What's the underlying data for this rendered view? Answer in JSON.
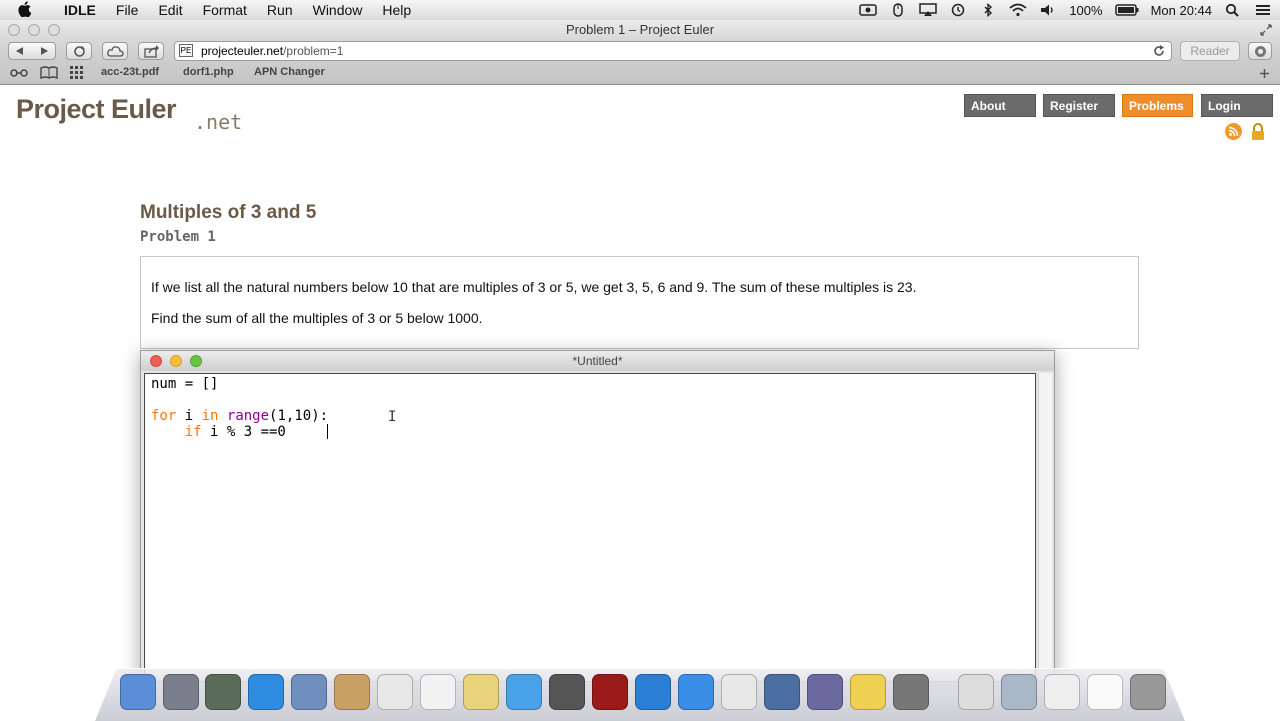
{
  "menubar": {
    "app": "IDLE",
    "menus": [
      "File",
      "Edit",
      "Format",
      "Run",
      "Window",
      "Help"
    ],
    "battery": "100%",
    "clock": "Mon 20:44"
  },
  "browser": {
    "window_title": "Problem 1 – Project Euler",
    "url_host": "projecteuler.net",
    "url_path": "/problem=1",
    "reader_label": "Reader",
    "bookmarks": [
      "acc-23t.pdf",
      "dorf1.php",
      "APN Changer"
    ]
  },
  "site": {
    "logo_main": "Project Euler",
    "logo_suffix": ".net",
    "nav": [
      "About",
      "Register",
      "Problems",
      "Login"
    ],
    "active_nav": "Problems",
    "accent_color": "#ef8d2b",
    "title_color": "#6b5a48"
  },
  "problem": {
    "title": "Multiples of 3 and 5",
    "number": "Problem 1",
    "paragraph1": "If we list all the natural numbers below 10 that are multiples of 3 or 5, we get 3, 5, 6 and 9. The sum of these multiples is 23.",
    "paragraph2": "Find the sum of all the multiples of 3 or 5 below 1000."
  },
  "idle_window": {
    "title": "*Untitled*",
    "code": {
      "line1": "num = []",
      "line3_kw_for": "for",
      "line3_var": " i ",
      "line3_kw_in": "in",
      "line3_sp": " ",
      "line3_builtin": "range",
      "line3_rest": "(1,10):",
      "line4_indent": "    ",
      "line4_kw_if": "if",
      "line4_rest": " i % 3 ==0"
    }
  },
  "dock": {
    "icons": [
      "finder-icon",
      "launchpad-icon",
      "photo-booth-icon",
      "safari-icon",
      "preview-icon",
      "mail-icon",
      "calendar-icon",
      "reminders-icon",
      "notes-icon",
      "messages-icon",
      "facetime-icon",
      "photo-slideshow-icon",
      "itunes-icon",
      "app-store-icon",
      "acrobat-icon",
      "remote-desktop-icon",
      "vpn-icon",
      "python-icon",
      "imovie-icon",
      "documents-icon",
      "windows-folder-icon",
      "keyboard-icon",
      "blank-doc-icon",
      "trash-icon"
    ]
  }
}
